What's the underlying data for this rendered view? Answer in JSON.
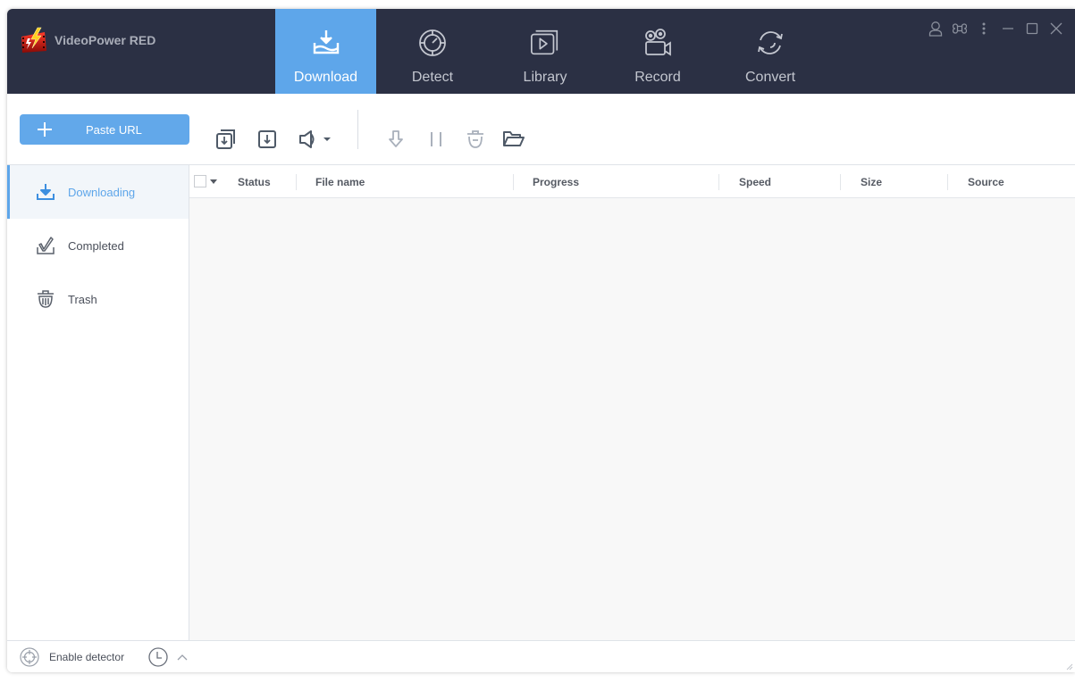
{
  "app": {
    "title": "VideoPower RED",
    "logo_icon": "film-lightning-logo"
  },
  "nav": {
    "tabs": [
      {
        "label": "Download",
        "icon": "download-tray-icon",
        "active": true
      },
      {
        "label": "Detect",
        "icon": "detect-target-icon",
        "active": false
      },
      {
        "label": "Library",
        "icon": "library-play-icon",
        "active": false
      },
      {
        "label": "Record",
        "icon": "video-camera-icon",
        "active": false
      },
      {
        "label": "Convert",
        "icon": "convert-cycle-icon",
        "active": false
      }
    ]
  },
  "window_controls": [
    "user-icon",
    "command-icon",
    "more-vertical-icon",
    "minimize-icon",
    "maximize-icon",
    "close-icon"
  ],
  "toolbar": {
    "paste_url_label": "Paste URL",
    "icons": [
      "batch-download-icon",
      "download-icon",
      "audio-speaker-icon",
      "resume-icon",
      "pause-icon",
      "delete-icon",
      "open-folder-icon"
    ]
  },
  "sidebar": {
    "items": [
      {
        "label": "Downloading",
        "icon": "downloading-icon",
        "active": true
      },
      {
        "label": "Completed",
        "icon": "completed-check-icon",
        "active": false
      },
      {
        "label": "Trash",
        "icon": "trash-icon",
        "active": false
      }
    ]
  },
  "table": {
    "columns": [
      "Status",
      "File name",
      "Progress",
      "Speed",
      "Size",
      "Source"
    ],
    "rows": []
  },
  "footer": {
    "enable_detector_label": "Enable detector"
  },
  "colors": {
    "header_bg": "#2b3044",
    "accent": "#5ea6ea",
    "paste_button": "#62a8ea"
  }
}
